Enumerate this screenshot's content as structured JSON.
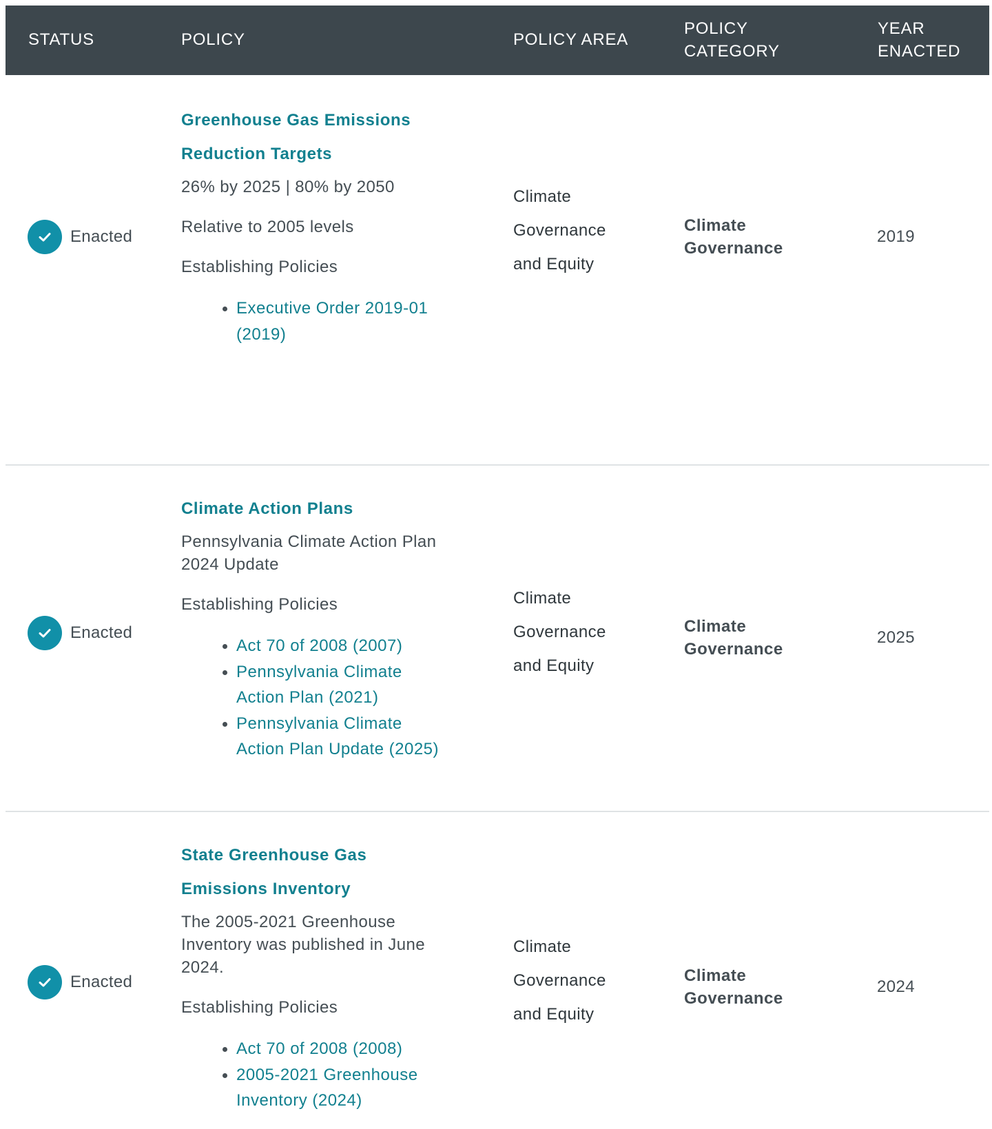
{
  "table": {
    "headers": {
      "status": "STATUS",
      "policy": "POLICY",
      "policy_area": "POLICY AREA",
      "policy_category_1": "POLICY",
      "policy_category_2": "CATEGORY",
      "year_enacted_1": "YEAR",
      "year_enacted_2": "ENACTED"
    },
    "rows": [
      {
        "status": "Enacted",
        "status_icon": "check-circle-icon",
        "title_1": "Greenhouse Gas Emissions",
        "title_2": "Reduction Targets",
        "desc_1": "26% by 2025 | 80% by 2050",
        "desc_2": "Relative to 2005 levels",
        "establishing_label": "Establishing Policies",
        "links": [
          {
            "l1": "Executive Order 2019-01",
            "l2": "(2019)"
          }
        ],
        "area_1": "Climate",
        "area_2": "Governance",
        "area_3": "and Equity",
        "category_1": "Climate",
        "category_2": "Governance",
        "year": "2019"
      },
      {
        "status": "Enacted",
        "status_icon": "check-circle-icon",
        "title_1": "Climate Action Plans",
        "desc_1": "Pennsylvania Climate Action Plan",
        "desc_2": "2024 Update",
        "establishing_label": "Establishing Policies",
        "links": [
          {
            "l1": "Act 70 of 2008 (2007)"
          },
          {
            "l1": "Pennsylvania Climate",
            "l2": "Action Plan (2021)"
          },
          {
            "l1": "Pennsylvania Climate",
            "l2": "Action Plan Update (2025)"
          }
        ],
        "area_1": "Climate",
        "area_2": "Governance",
        "area_3": "and Equity",
        "category_1": "Climate",
        "category_2": "Governance",
        "year": "2025"
      },
      {
        "status": "Enacted",
        "status_icon": "check-circle-icon",
        "title_1": "State Greenhouse Gas",
        "title_2": "Emissions Inventory",
        "desc_1": "The 2005-2021 Greenhouse",
        "desc_2": "Inventory was published in June",
        "desc_3": "2024.",
        "establishing_label": "Establishing Policies",
        "links": [
          {
            "l1": "Act 70 of 2008 (2008)"
          },
          {
            "l1": "2005-2021 Greenhouse",
            "l2": "Inventory (2024)"
          }
        ],
        "area_1": "Climate",
        "area_2": "Governance",
        "area_3": "and Equity",
        "category_1": "Climate",
        "category_2": "Governance",
        "year": "2024"
      }
    ]
  },
  "colors": {
    "header_bg": "#3d474d",
    "link": "#12808f",
    "check": "#1190a8",
    "divider": "#dfe3e5"
  }
}
